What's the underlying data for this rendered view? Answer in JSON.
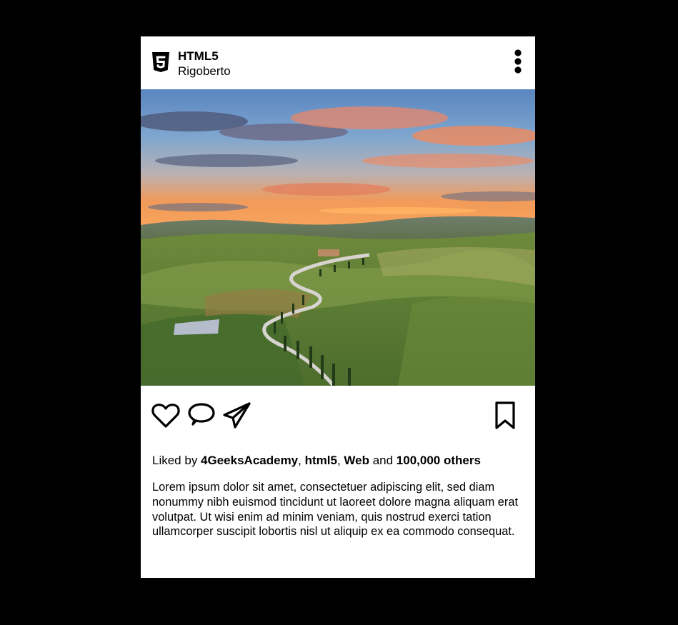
{
  "post": {
    "account_name": "HTML5",
    "location": "Rigoberto",
    "logo_icon": "html5-icon",
    "menu_icon": "more-vertical-icon",
    "image_description_icon": "landscape-photo",
    "actions": {
      "like_icon": "heart-icon",
      "comment_icon": "comment-icon",
      "share_icon": "send-icon",
      "save_icon": "bookmark-icon"
    },
    "likes": {
      "prefix": "Liked by ",
      "user1": "4GeeksAcademy",
      "sep1": ", ",
      "user2": "html5",
      "sep2": ", ",
      "user3": "Web",
      "conj": " and ",
      "others": "100,000 others"
    },
    "caption": "Lorem ipsum dolor sit amet, consectetuer adipiscing elit, sed diam nonummy nibh euismod tincidunt ut laoreet dolore magna aliquam erat volutpat. Ut wisi enim ad minim veniam, quis nostrud exerci tation ullamcorper suscipit lobortis nisl ut aliquip ex ea commodo consequat."
  },
  "colors": {
    "page_background": "#000000",
    "card_background": "#ffffff",
    "text": "#000000"
  }
}
